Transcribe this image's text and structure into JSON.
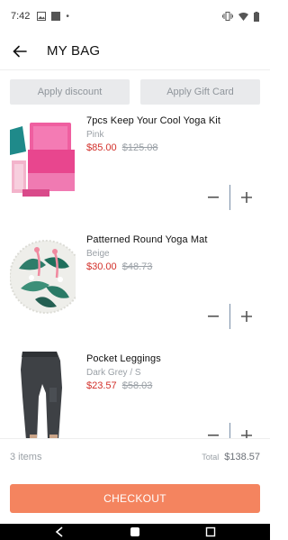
{
  "status_bar": {
    "time": "7:42",
    "dot": "•"
  },
  "app_bar": {
    "title": "MY BAG"
  },
  "actions": {
    "apply_discount": "Apply discount",
    "apply_gift_card": "Apply Gift Card"
  },
  "items": [
    {
      "name": "7pcs Keep Your Cool Yoga Kit",
      "variant": "Pink",
      "price": "$85.00",
      "old_price": "$125.08"
    },
    {
      "name": "Patterned Round Yoga Mat",
      "variant": "Beige",
      "price": "$30.00",
      "old_price": "$48.73"
    },
    {
      "name": "Pocket Leggings",
      "variant": "Dark Grey / S",
      "price": "$23.57",
      "old_price": "$58.03"
    }
  ],
  "summary": {
    "count": "3 items",
    "total_label": "Total",
    "total_value": "$138.57"
  },
  "checkout": {
    "label": "CHECKOUT"
  },
  "colors": {
    "accent": "#f4845f",
    "price": "#d2302a",
    "muted": "#9aa0a6"
  }
}
